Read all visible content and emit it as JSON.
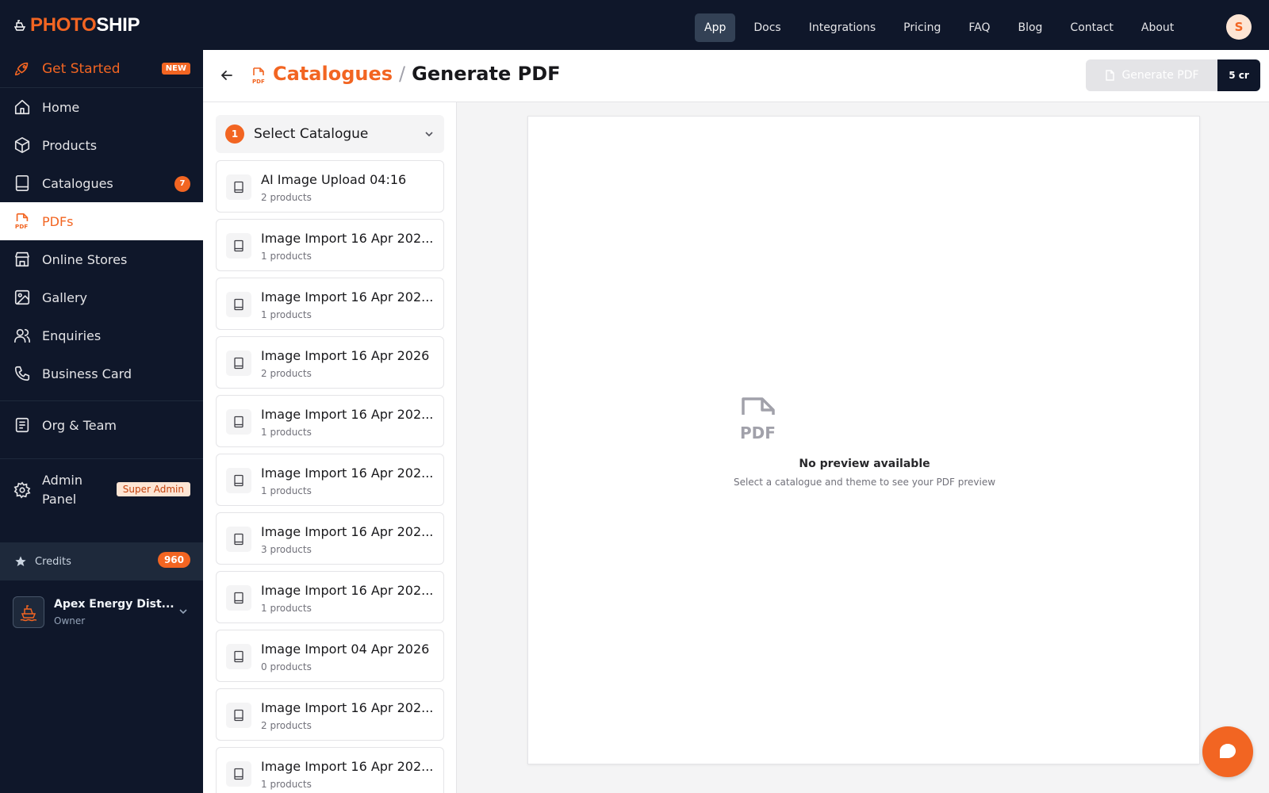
{
  "brand": {
    "part1": "PHOTO",
    "part2": "SHIP"
  },
  "nav": {
    "items": [
      {
        "label": "App",
        "active": true
      },
      {
        "label": "Docs"
      },
      {
        "label": "Integrations"
      },
      {
        "label": "Pricing"
      },
      {
        "label": "FAQ"
      },
      {
        "label": "Blog"
      },
      {
        "label": "Contact"
      },
      {
        "label": "About"
      }
    ],
    "avatar_initial": "S"
  },
  "sidebar": {
    "get_started": {
      "label": "Get Started",
      "badge": "NEW"
    },
    "items": [
      {
        "label": "Home",
        "icon": "home-icon"
      },
      {
        "label": "Products",
        "icon": "box-icon"
      },
      {
        "label": "Catalogues",
        "icon": "book-icon",
        "badge": "7"
      },
      {
        "label": "PDFs",
        "icon": "pdf-icon",
        "active": true
      },
      {
        "label": "Online Stores",
        "icon": "store-icon"
      },
      {
        "label": "Gallery",
        "icon": "image-icon"
      },
      {
        "label": "Enquiries",
        "icon": "users-icon"
      },
      {
        "label": "Business Card",
        "icon": "phone-icon"
      }
    ],
    "org_team": {
      "label": "Org & Team",
      "icon": "list-icon"
    },
    "admin": {
      "label_line1": "Admin",
      "label_line2": "Panel",
      "badge": "Super Admin",
      "icon": "gear-icon"
    },
    "credits": {
      "label": "Credits",
      "value": "960",
      "icon": "star-icon"
    },
    "org": {
      "name": "Apex Energy Dist...",
      "role": "Owner"
    }
  },
  "header": {
    "breadcrumb_link": "Catalogues",
    "breadcrumb_sep": "/",
    "breadcrumb_current": "Generate PDF",
    "generate_label": "Generate PDF",
    "cost_label": "5 cr"
  },
  "catalogue_panel": {
    "step": "1",
    "title": "Select Catalogue",
    "items": [
      {
        "name": "AI Image Upload 04:16",
        "count": "2 products"
      },
      {
        "name": "Image Import 16 Apr 202...",
        "count": "1 products"
      },
      {
        "name": "Image Import 16 Apr 202...",
        "count": "1 products"
      },
      {
        "name": "Image Import 16 Apr 2026",
        "count": "2 products"
      },
      {
        "name": "Image Import 16 Apr 202...",
        "count": "1 products"
      },
      {
        "name": "Image Import 16 Apr 202...",
        "count": "1 products"
      },
      {
        "name": "Image Import 16 Apr 202...",
        "count": "3 products"
      },
      {
        "name": "Image Import 16 Apr 202...",
        "count": "1 products"
      },
      {
        "name": "Image Import 04 Apr 2026",
        "count": "0 products"
      },
      {
        "name": "Image Import 16 Apr 202...",
        "count": "2 products"
      },
      {
        "name": "Image Import 16 Apr 202...",
        "count": "1 products"
      }
    ]
  },
  "preview": {
    "empty_title": "No preview available",
    "empty_subtitle": "Select a catalogue and theme to see your PDF preview"
  },
  "colors": {
    "accent": "#f26522",
    "navy": "#0f172a"
  }
}
